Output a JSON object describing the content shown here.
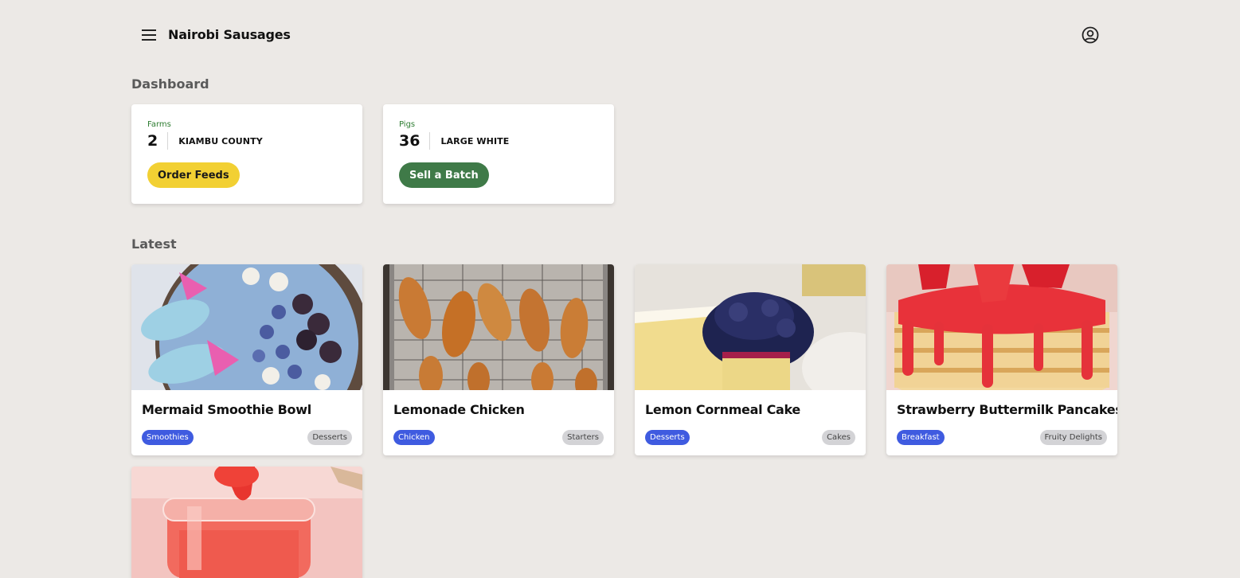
{
  "header": {
    "app_title": "Nairobi Sausages"
  },
  "dashboard": {
    "title": "Dashboard",
    "cards": [
      {
        "label": "Farms",
        "value": "2",
        "sub": "KIAMBU COUNTY",
        "button": "Order Feeds",
        "button_color": "#f2d033"
      },
      {
        "label": "Pigs",
        "value": "36",
        "sub": "LARGE WHITE",
        "button": "Sell a Batch",
        "button_color": "#3f7a48"
      }
    ]
  },
  "latest": {
    "title": "Latest",
    "recipes": [
      {
        "title": "Mermaid Smoothie Bowl",
        "tag_primary": "Smoothies",
        "tag_secondary": "Desserts"
      },
      {
        "title": "Lemonade Chicken",
        "tag_primary": "Chicken",
        "tag_secondary": "Starters"
      },
      {
        "title": "Lemon Cornmeal Cake",
        "tag_primary": "Desserts",
        "tag_secondary": "Cakes"
      },
      {
        "title": "Strawberry Buttermilk Pancakes",
        "tag_primary": "Breakfast",
        "tag_secondary": "Fruity Delights"
      }
    ]
  },
  "colors": {
    "background": "#ece9e6",
    "tag_primary": "#3f5be0",
    "tag_secondary": "#d3d3d6",
    "farm_label": "#2e7d32"
  }
}
